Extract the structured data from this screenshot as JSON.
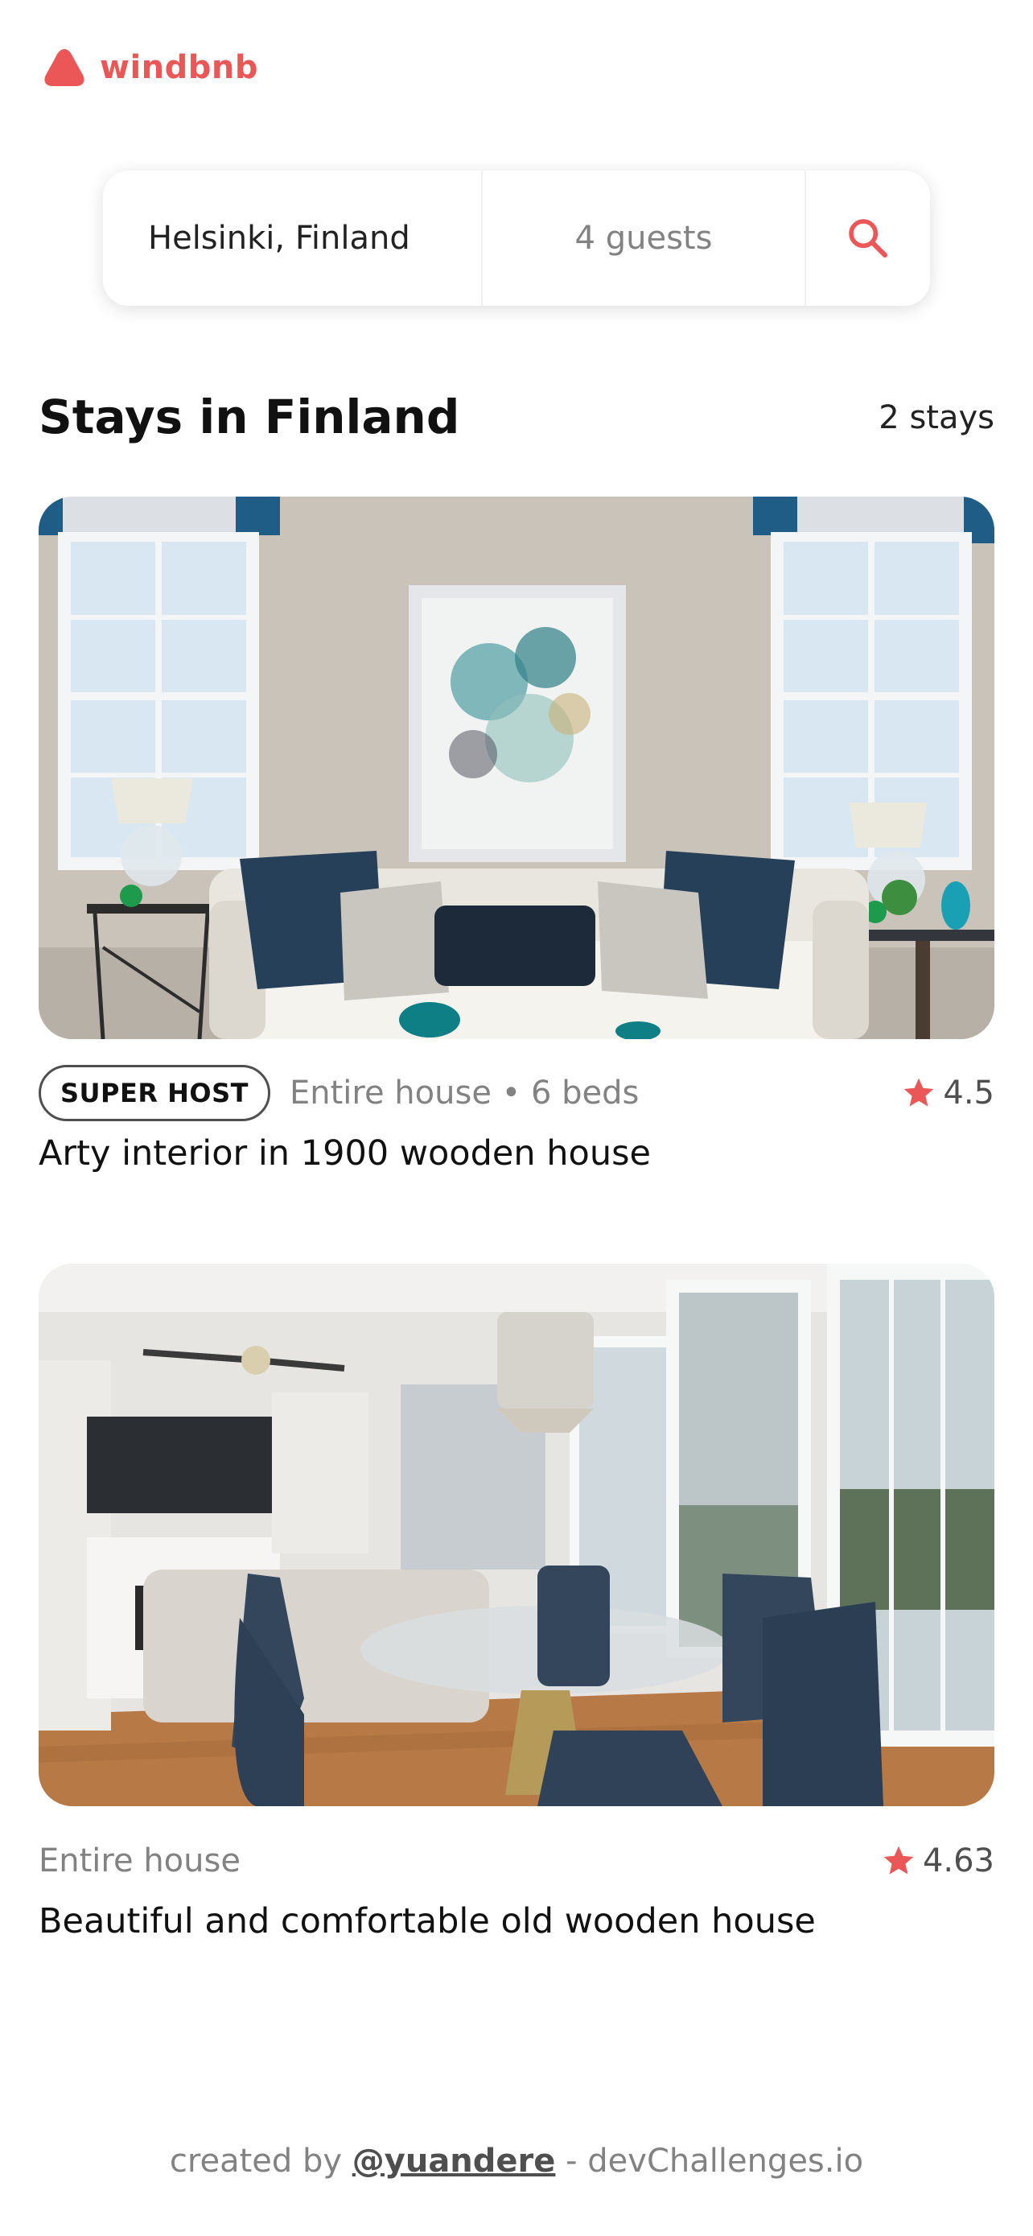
{
  "app": {
    "name": "windbnb",
    "brand_color": "#eb5757"
  },
  "search": {
    "location": "Helsinki, Finland",
    "guests": "4 guests",
    "button_icon": "search-icon"
  },
  "listing": {
    "title": "Stays in Finland",
    "count": "2 stays"
  },
  "stays": [
    {
      "badge": "SUPER HOST",
      "type": "Entire house • 6 beds",
      "rating": "4.5",
      "title": "Arty interior in 1900 wooden house"
    },
    {
      "type": "Entire house",
      "rating": "4.63",
      "title": "Beautiful and comfortable old wooden house"
    }
  ],
  "footer": {
    "prefix": "created by",
    "handle": "@yuandere",
    "suffix": "- devChallenges.io"
  }
}
